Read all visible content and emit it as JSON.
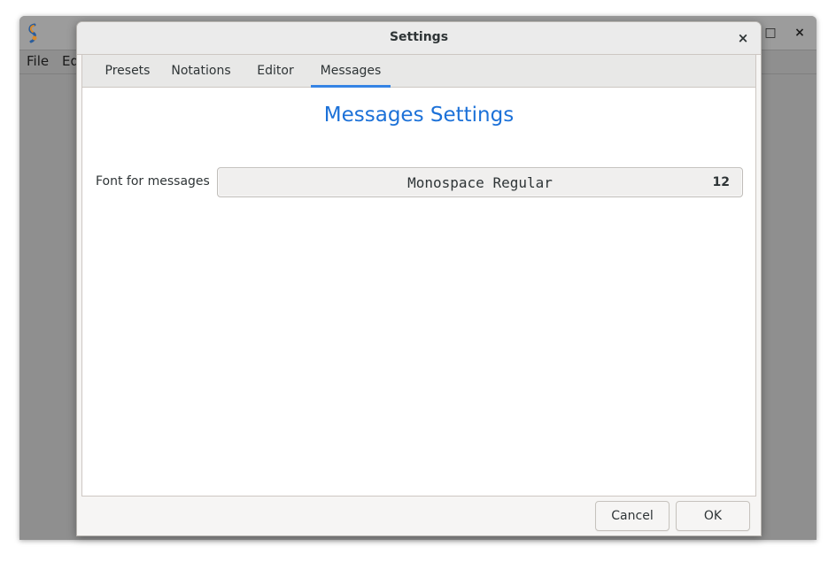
{
  "main_window": {
    "menu": [
      "File",
      "Ed"
    ],
    "controls": {
      "maximize": "□",
      "close": "×"
    }
  },
  "dialog": {
    "title": "Settings",
    "close_glyph": "×",
    "tabs": [
      {
        "label": "Presets",
        "active": false
      },
      {
        "label": "Notations",
        "active": false
      },
      {
        "label": "Editor",
        "active": false
      },
      {
        "label": "Messages",
        "active": true
      }
    ],
    "heading": "Messages Settings",
    "font_field": {
      "label": "Font for messages",
      "font_name": "Monospace Regular",
      "font_size": "12"
    },
    "buttons": {
      "cancel": "Cancel",
      "ok": "OK"
    }
  },
  "colors": {
    "accent": "#3584e4",
    "heading": "#1c71d8",
    "window_dim": "#8f8f8f"
  }
}
